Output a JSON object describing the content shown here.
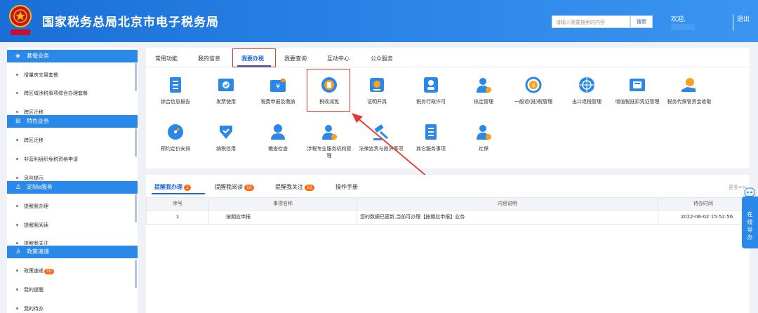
{
  "header": {
    "title": "国家税务总局北京市电子税务局",
    "search_placeholder": "请输入需要搜索的内容",
    "search_button": "搜索",
    "welcome": "欢迎,",
    "logout": "退出",
    "logo_text": "中国税务"
  },
  "sidebar": {
    "sections": [
      {
        "title": "套餐业务",
        "items": [
          "增量房交易套餐",
          "跨区域涉税事项综合办理套餐",
          "跨区迁移"
        ]
      },
      {
        "title": "特色业务",
        "items": [
          "跨区迁移",
          "非营利组织免税资格申请",
          "风险提示"
        ]
      },
      {
        "title": "定制e服务",
        "items": [
          "提醒我办理",
          "提醒我阅读",
          "提醒我关注"
        ]
      },
      {
        "title": "政策速递",
        "items": [
          "政策速递",
          "我的提醒",
          "我的待办"
        ],
        "badge": "10"
      }
    ]
  },
  "main": {
    "tabs": [
      "常用功能",
      "我的信息",
      "我要办税",
      "我要查询",
      "互动中心",
      "公众服务"
    ],
    "active_tab": "我要办税",
    "services": [
      {
        "label": "综合信息报告",
        "icon": "doc-report-icon"
      },
      {
        "label": "发票使用",
        "icon": "invoice-icon"
      },
      {
        "label": "税费申报及缴纳",
        "icon": "wallet-yen-icon"
      },
      {
        "label": "税收减免",
        "icon": "tax-relief-icon"
      },
      {
        "label": "证明开具",
        "icon": "certificate-icon"
      },
      {
        "label": "税务行政许可",
        "icon": "admin-permit-icon"
      },
      {
        "label": "核定管理",
        "icon": "person-gear-icon"
      },
      {
        "label": "一般退(抵)税管理",
        "icon": "refund-cycle-icon"
      },
      {
        "label": "出口退税管理",
        "icon": "export-refund-icon"
      },
      {
        "label": "增值税抵扣凭证管理",
        "icon": "vat-voucher-icon"
      },
      {
        "label": "税务代保管资金收取",
        "icon": "hand-bag-icon"
      },
      {
        "label": "预约定价安排",
        "icon": "gauge-icon"
      },
      {
        "label": "纳税信用",
        "icon": "credit-shield-icon"
      },
      {
        "label": "稽查检查",
        "icon": "inspector-icon"
      },
      {
        "label": "涉税专业服务机构管理",
        "icon": "agency-icon"
      },
      {
        "label": "法律追责与救济事项",
        "icon": "gavel-icon"
      },
      {
        "label": "其它服务事项",
        "icon": "other-doc-icon"
      },
      {
        "label": "社保",
        "icon": "social-security-icon"
      }
    ]
  },
  "reminders": {
    "tabs": [
      {
        "label": "提醒我办理",
        "badge": "1"
      },
      {
        "label": "提醒我阅读",
        "badge": "10"
      },
      {
        "label": "提醒我关注",
        "badge": "12"
      },
      {
        "label": "操作手册",
        "badge": ""
      }
    ],
    "more": "更多>>",
    "columns": [
      "序号",
      "事项名称",
      "内容说明",
      "待办时间"
    ],
    "rows": [
      {
        "no": "1",
        "name": "按期应申报",
        "desc": "您的数据已更新,当前可办理【按期应申报】业务",
        "time": "2022-06-02 15:52:56"
      }
    ]
  },
  "float": {
    "guide": [
      "在",
      "线",
      "导",
      "办"
    ]
  },
  "colors": {
    "header": "#2079e0",
    "accent": "#1d6ad6",
    "badge": "#ff6a13",
    "highlight": "#e53935"
  }
}
